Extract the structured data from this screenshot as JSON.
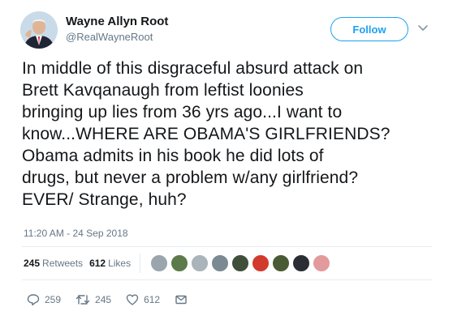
{
  "author": {
    "name": "Wayne Allyn Root",
    "handle": "@RealWayneRoot"
  },
  "follow_label": "Follow",
  "tweet_text": "In middle of this disgraceful absurd attack on\nBrett Kavqanaugh from leftist loonies\nbringing up lies from 36 yrs ago...I want to\nknow...WHERE ARE OBAMA'S GIRLFRIENDS?\nObama admits in his book he did lots of\ndrugs, but never a problem w/any girlfriend?\nEVER/ Strange, huh?",
  "timestamp": "11:20 AM - 24 Sep 2018",
  "stats": {
    "retweets_count": "245",
    "retweets_label": "Retweets",
    "likes_count": "612",
    "likes_label": "Likes"
  },
  "liker_avatars": 9,
  "actions": {
    "reply_count": "259",
    "retweet_count": "245",
    "like_count": "612"
  },
  "icons": {
    "reply": "reply-icon",
    "retweet": "retweet-icon",
    "like": "heart-icon",
    "message": "envelope-icon",
    "menu": "chevron-down-icon"
  },
  "colors": {
    "accent": "#1da1f2",
    "text": "#14171a",
    "muted": "#657786"
  }
}
